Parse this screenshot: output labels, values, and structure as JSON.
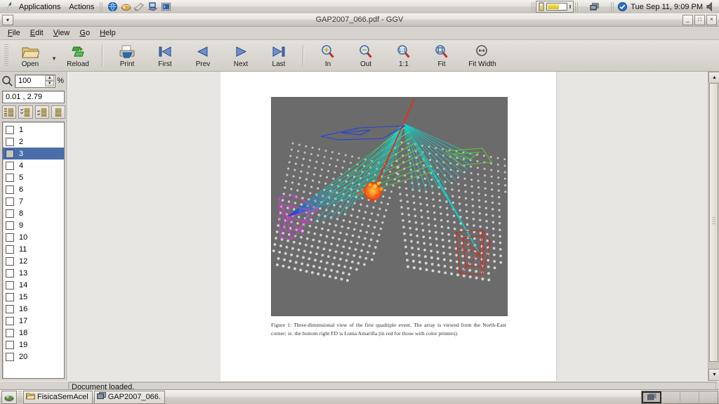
{
  "panel": {
    "applications_label": "Applications",
    "actions_label": "Actions",
    "launchers": [
      "web-browser-icon",
      "email-icon",
      "text-editor-icon",
      "help-icon",
      "terminal-icon"
    ],
    "clock": "Tue Sep 11,  9:09 PM",
    "battery_icon": "battery-icon",
    "network_icon": "network-monitor-icon",
    "volume_icon": "volume-icon",
    "clock_check_icon": "clock-check-icon"
  },
  "window": {
    "title": "GAP2007_066.pdf - GGV",
    "menu_button_icon": "window-menu-icon",
    "buttons": {
      "minimize": "_",
      "maximize": "□",
      "close": "×"
    }
  },
  "menubar": {
    "items": [
      {
        "label": "File",
        "mnemonic": "F"
      },
      {
        "label": "Edit",
        "mnemonic": "E"
      },
      {
        "label": "View",
        "mnemonic": "V"
      },
      {
        "label": "Go",
        "mnemonic": "G"
      },
      {
        "label": "Help",
        "mnemonic": "H"
      }
    ]
  },
  "toolbar": {
    "items": [
      {
        "label": "Open",
        "icon": "folder-open-icon"
      },
      {
        "label": "Reload",
        "icon": "reload-icon"
      },
      {
        "label": "Print",
        "icon": "printer-icon"
      },
      {
        "label": "First",
        "icon": "first-page-icon"
      },
      {
        "label": "Prev",
        "icon": "previous-page-icon"
      },
      {
        "label": "Next",
        "icon": "next-page-icon"
      },
      {
        "label": "Last",
        "icon": "last-page-icon"
      },
      {
        "label": "In",
        "icon": "zoom-in-icon"
      },
      {
        "label": "Out",
        "icon": "zoom-out-icon"
      },
      {
        "label": "1:1",
        "icon": "zoom-original-icon"
      },
      {
        "label": "Fit",
        "icon": "zoom-fit-icon"
      },
      {
        "label": "Fit Width",
        "icon": "zoom-fit-width-icon"
      }
    ],
    "open_dropdown_icon": "chevron-down-icon"
  },
  "sidebar": {
    "zoom": {
      "value": "100",
      "unit": "%",
      "icon": "magnifier-icon"
    },
    "coordinates": "0.01 , 2.79",
    "select_buttons": [
      {
        "icon": "select-all-pages-icon"
      },
      {
        "icon": "select-odd-pages-icon"
      },
      {
        "icon": "select-even-pages-icon"
      },
      {
        "icon": "deselect-all-pages-icon"
      }
    ],
    "pages": [
      {
        "number": "1",
        "checked": false,
        "selected": false
      },
      {
        "number": "2",
        "checked": false,
        "selected": false
      },
      {
        "number": "3",
        "checked": false,
        "selected": true
      },
      {
        "number": "4",
        "checked": false,
        "selected": false
      },
      {
        "number": "5",
        "checked": false,
        "selected": false
      },
      {
        "number": "6",
        "checked": false,
        "selected": false
      },
      {
        "number": "7",
        "checked": false,
        "selected": false
      },
      {
        "number": "8",
        "checked": false,
        "selected": false
      },
      {
        "number": "9",
        "checked": false,
        "selected": false
      },
      {
        "number": "10",
        "checked": false,
        "selected": false
      },
      {
        "number": "11",
        "checked": false,
        "selected": false
      },
      {
        "number": "12",
        "checked": false,
        "selected": false
      },
      {
        "number": "13",
        "checked": false,
        "selected": false
      },
      {
        "number": "14",
        "checked": false,
        "selected": false
      },
      {
        "number": "15",
        "checked": false,
        "selected": false
      },
      {
        "number": "16",
        "checked": false,
        "selected": false
      },
      {
        "number": "17",
        "checked": false,
        "selected": false
      },
      {
        "number": "18",
        "checked": false,
        "selected": false
      },
      {
        "number": "19",
        "checked": false,
        "selected": false
      },
      {
        "number": "20",
        "checked": false,
        "selected": false
      }
    ]
  },
  "document": {
    "figure_caption": "Figure 1: Three-dimensional view of the first quadriple event. The array is viewed from the North-East corner; ie. the bottom right FD is Loma Amarilla (in red for those with color printers).",
    "figure_alt": "three-dimensional-detector-array-view",
    "figure_background": "#6b6b6b"
  },
  "statusbar": {
    "message": "Document loaded."
  },
  "taskbar": {
    "show_desktop_icon": "show-desktop-icon",
    "tasks": [
      {
        "label": "FisicaSemAcel",
        "icon": "folder-icon"
      },
      {
        "label": "GAP2007_066.",
        "icon": "document-window-icon"
      }
    ],
    "workspaces": [
      {
        "active": true
      },
      {
        "active": false
      },
      {
        "active": false
      },
      {
        "active": false
      }
    ]
  }
}
